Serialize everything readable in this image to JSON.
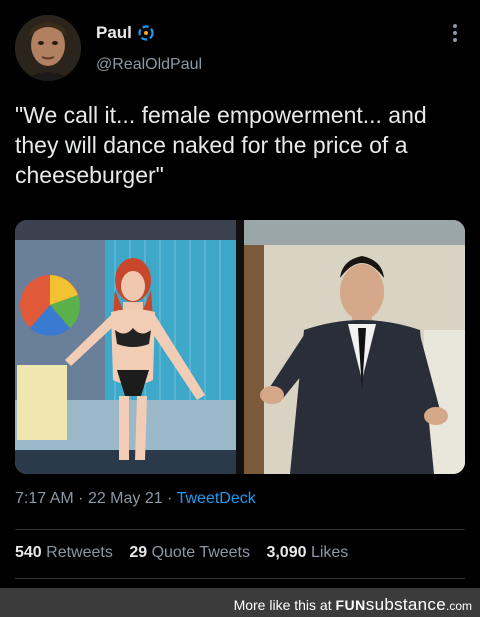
{
  "author": {
    "name": "Paul",
    "handle": "@RealOldPaul"
  },
  "tweet": {
    "text": "\"We call it... female empowerment... and they will dance naked for the price of a cheeseburger\"",
    "time": "7:17 AM",
    "date": "22 May 21",
    "app": "TweetDeck",
    "separator": "·"
  },
  "stats": {
    "retweets_count": "540",
    "retweets_label": "Retweets",
    "quotes_count": "29",
    "quotes_label": "Quote Tweets",
    "likes_count": "3,090",
    "likes_label": "Likes"
  },
  "media": {
    "left_image": "streamer-photo",
    "right_image": "man-in-suit-photo"
  },
  "footer": {
    "prefix": "More like this at",
    "brand_part1": "FUN",
    "brand_part2": "substance",
    "brand_part3": ".com"
  },
  "colors": {
    "background": "#000000",
    "text": "#e7e9ea",
    "muted": "#8b98a5",
    "link": "#1d9bf0",
    "footer_bg": "#3b3b3b"
  }
}
